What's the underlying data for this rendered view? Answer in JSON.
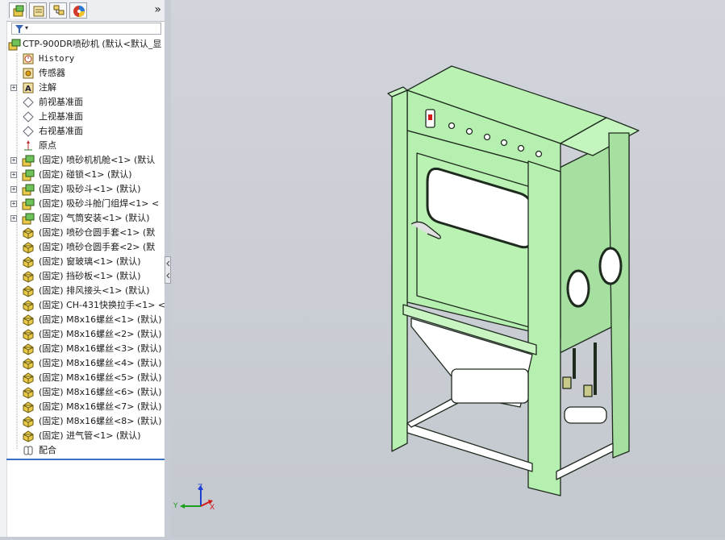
{
  "tabs": [
    {
      "name": "featuremanager-tab",
      "icon": "feature-tree-icon"
    },
    {
      "name": "propertymanager-tab",
      "icon": "property-icon"
    },
    {
      "name": "configurationmanager-tab",
      "icon": "configuration-icon"
    },
    {
      "name": "appearance-tab",
      "icon": "appearance-icon"
    }
  ],
  "overflow_label": "»",
  "filter_caret": "▾",
  "tree": {
    "root": "CTP-900DR喷砂机  (默认<默认_显",
    "items": [
      {
        "label": "History",
        "icon": "history-icon",
        "expand": false,
        "mono": true
      },
      {
        "label": "传感器",
        "icon": "sensor-icon",
        "expand": false
      },
      {
        "label": "注解",
        "icon": "annotation-icon",
        "expand": true
      },
      {
        "label": "前视基准面",
        "icon": "plane-icon",
        "expand": false
      },
      {
        "label": "上视基准面",
        "icon": "plane-icon",
        "expand": false
      },
      {
        "label": "右视基准面",
        "icon": "plane-icon",
        "expand": false
      },
      {
        "label": "原点",
        "icon": "origin-icon",
        "expand": false
      },
      {
        "label": "(固定) 喷砂机机舱<1> (默认",
        "icon": "subassembly-icon",
        "expand": true
      },
      {
        "label": "(固定) 碰锁<1> (默认)",
        "icon": "subassembly-icon",
        "expand": true
      },
      {
        "label": "(固定) 吸砂斗<1> (默认)",
        "icon": "subassembly-icon",
        "expand": true
      },
      {
        "label": "(固定) 吸砂斗舱门组焊<1> <",
        "icon": "subassembly-icon",
        "expand": true
      },
      {
        "label": "(固定) 气筒安装<1> (默认)",
        "icon": "subassembly-icon",
        "expand": true
      },
      {
        "label": "(固定) 喷砂仓圆手套<1> (默",
        "icon": "part-icon",
        "expand": false
      },
      {
        "label": "(固定) 喷砂仓圆手套<2> (默",
        "icon": "part-icon",
        "expand": false
      },
      {
        "label": "(固定) 窗玻璃<1> (默认)",
        "icon": "part-icon",
        "expand": false
      },
      {
        "label": "(固定) 挡砂板<1> (默认)",
        "icon": "part-icon",
        "expand": false
      },
      {
        "label": "(固定) 排风接头<1> (默认)",
        "icon": "part-icon",
        "expand": false
      },
      {
        "label": "(固定) CH-431快换拉手<1> <",
        "icon": "part-icon",
        "expand": false
      },
      {
        "label": "(固定) M8x16螺丝<1> (默认)",
        "icon": "part-icon",
        "expand": false
      },
      {
        "label": "(固定) M8x16螺丝<2> (默认)",
        "icon": "part-icon",
        "expand": false
      },
      {
        "label": "(固定) M8x16螺丝<3> (默认)",
        "icon": "part-icon",
        "expand": false
      },
      {
        "label": "(固定) M8x16螺丝<4> (默认)",
        "icon": "part-icon",
        "expand": false
      },
      {
        "label": "(固定) M8x16螺丝<5> (默认)",
        "icon": "part-icon",
        "expand": false
      },
      {
        "label": "(固定) M8x16螺丝<6> (默认)",
        "icon": "part-icon",
        "expand": false
      },
      {
        "label": "(固定) M8x16螺丝<7> (默认)",
        "icon": "part-icon",
        "expand": false
      },
      {
        "label": "(固定) M8x16螺丝<8> (默认)",
        "icon": "part-icon",
        "expand": false
      },
      {
        "label": "(固定) 进气管<1> (默认)",
        "icon": "part-icon",
        "expand": false
      },
      {
        "label": "配合",
        "icon": "mates-icon",
        "expand": false
      }
    ]
  },
  "triad": {
    "x": "X",
    "y": "Y",
    "z": "Z"
  },
  "colors": {
    "model_green": "#b6f0b0",
    "model_edge": "#1f2a1f",
    "axis_x": "#d21b1b",
    "axis_y": "#1aa01a",
    "axis_z": "#1f3fd0",
    "viewport": "#c7cbd3"
  }
}
